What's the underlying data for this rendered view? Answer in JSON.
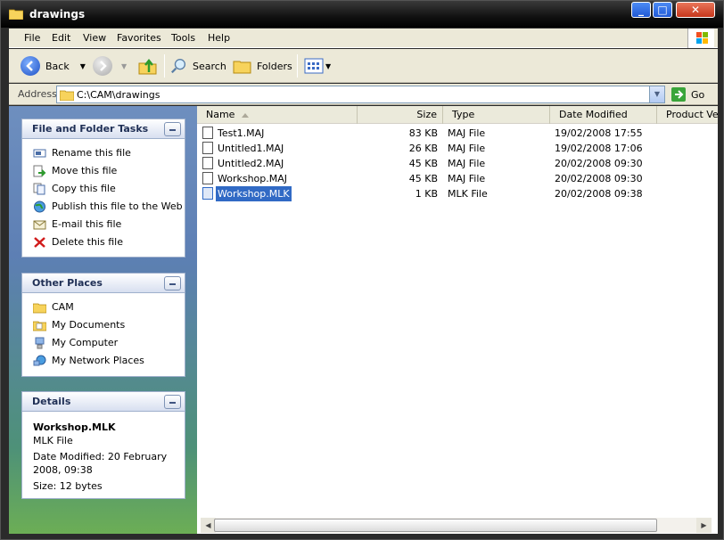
{
  "window": {
    "title": "drawings"
  },
  "menu": [
    "File",
    "Edit",
    "View",
    "Favorites",
    "Tools",
    "Help"
  ],
  "toolbar": {
    "back_label": "Back",
    "search_label": "Search",
    "folders_label": "Folders"
  },
  "address": {
    "label": "Address",
    "value": "C:\\CAM\\drawings",
    "go_label": "Go"
  },
  "tasks_panel": {
    "title": "File and Folder Tasks",
    "items": [
      "Rename this file",
      "Move this file",
      "Copy this file",
      "Publish this file to the Web",
      "E-mail this file",
      "Delete this file"
    ]
  },
  "places_panel": {
    "title": "Other Places",
    "items": [
      "CAM",
      "My Documents",
      "My Computer",
      "My Network Places"
    ]
  },
  "details_panel": {
    "title": "Details",
    "name": "Workshop.MLK",
    "type": "MLK File",
    "modified": "Date Modified: 20 February 2008, 09:38",
    "size": "Size: 12 bytes"
  },
  "columns": [
    "Name",
    "Size",
    "Type",
    "Date Modified",
    "Product Vers"
  ],
  "files": [
    {
      "name": "Test1.MAJ",
      "size": "83 KB",
      "type": "MAJ File",
      "modified": "19/02/2008 17:55"
    },
    {
      "name": "Untitled1.MAJ",
      "size": "26 KB",
      "type": "MAJ File",
      "modified": "19/02/2008 17:06"
    },
    {
      "name": "Untitled2.MAJ",
      "size": "45 KB",
      "type": "MAJ File",
      "modified": "20/02/2008 09:30"
    },
    {
      "name": "Workshop.MAJ",
      "size": "45 KB",
      "type": "MAJ File",
      "modified": "20/02/2008 09:30"
    },
    {
      "name": "Workshop.MLK",
      "size": "1 KB",
      "type": "MLK File",
      "modified": "20/02/2008 09:38"
    }
  ],
  "colors": {
    "selection": "#316ac5",
    "titlebar": "#111111"
  }
}
